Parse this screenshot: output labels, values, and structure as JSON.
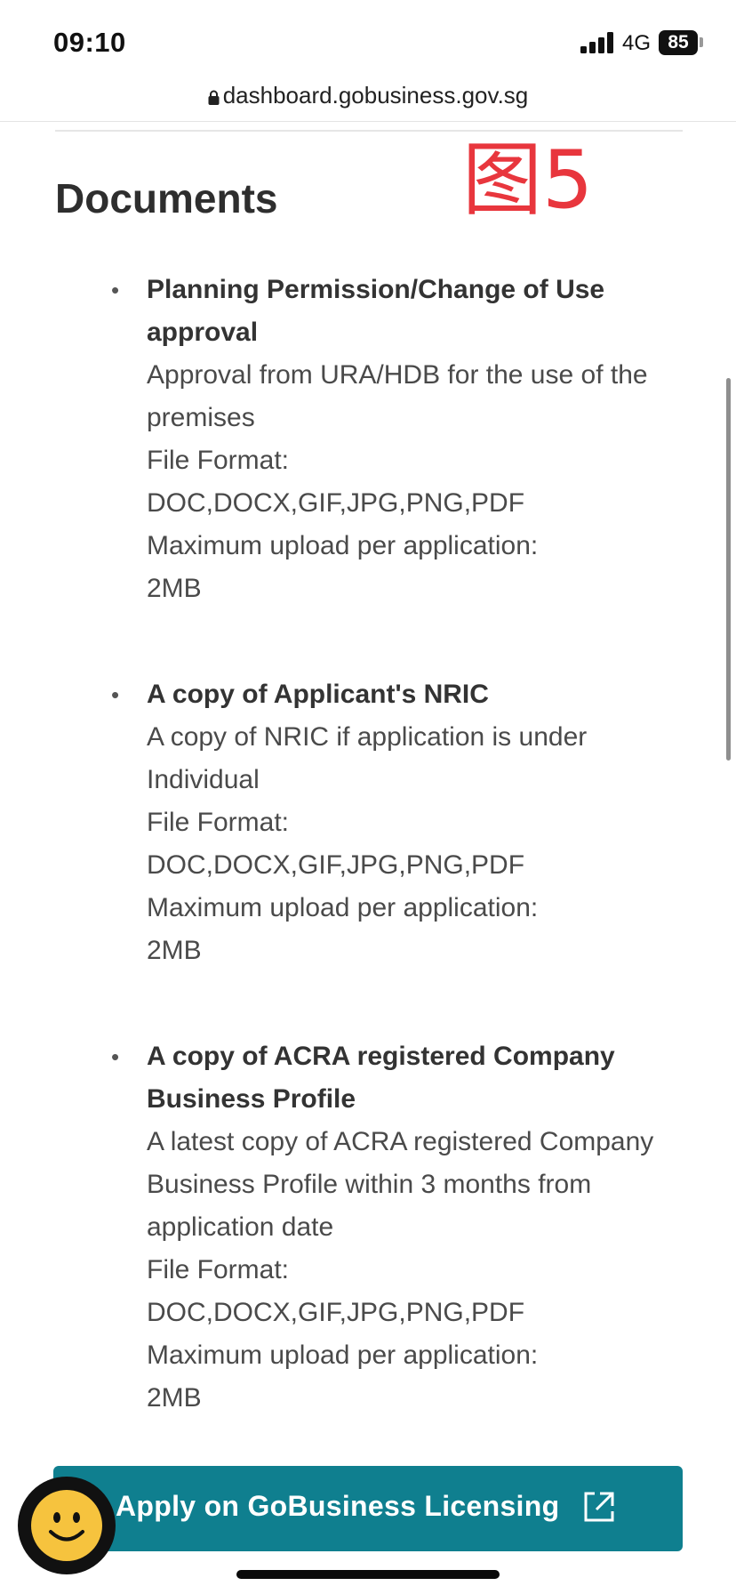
{
  "status_bar": {
    "time": "09:10",
    "network": "4G",
    "battery": "85"
  },
  "browser": {
    "url": "dashboard.gobusiness.gov.sg"
  },
  "annotation": "图5",
  "page": {
    "title": "Documents"
  },
  "documents": [
    {
      "name": "Planning Permission/Change of Use approval",
      "description": "Approval from URA/HDB for the use of the premises",
      "format_label": "File Format:",
      "formats": "DOC,DOCX,GIF,JPG,PNG,PDF",
      "max_label": "Maximum upload per application:",
      "max_size": "2MB"
    },
    {
      "name": "A copy of Applicant's NRIC",
      "description": "A copy of NRIC if application is under Individual",
      "format_label": "File Format:",
      "formats": "DOC,DOCX,GIF,JPG,PNG,PDF",
      "max_label": "Maximum upload per application:",
      "max_size": "2MB"
    },
    {
      "name": "A copy of ACRA registered Company Business Profile",
      "description": "A latest copy of ACRA registered Company Business Profile within 3 months from application date",
      "format_label": "File Format:",
      "formats": "DOC,DOCX,GIF,JPG,PNG,PDF",
      "max_label": "Maximum upload per application:",
      "max_size": "2MB"
    }
  ],
  "apply_button": {
    "label": "Apply on GoBusiness Licensing",
    "icon": "external-link-icon"
  },
  "chat": {
    "icon": "smiley-icon"
  },
  "colors": {
    "accent": "#0f7f8f",
    "annotation": "#e8363d",
    "chat_face": "#f6c33e"
  }
}
